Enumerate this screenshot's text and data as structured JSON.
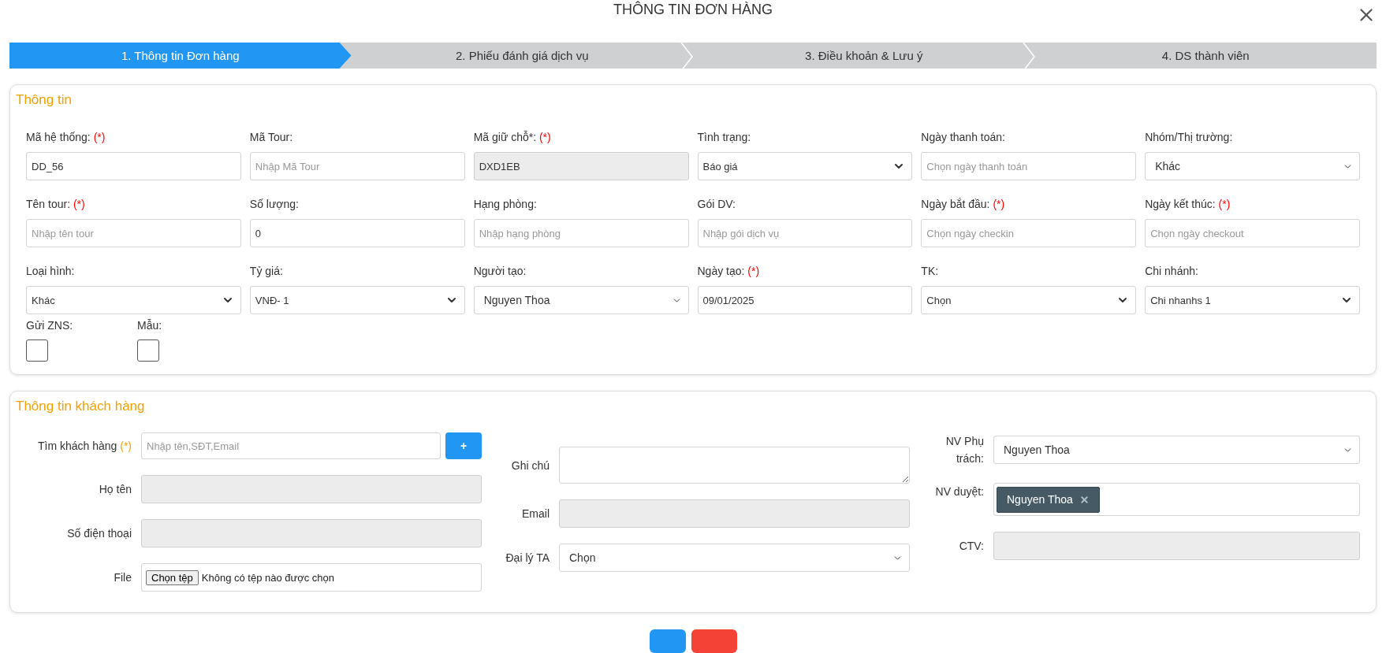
{
  "dialog": {
    "title": "THÔNG TIN ĐƠN HÀNG"
  },
  "steps": [
    {
      "label": "1. Thông tin Đơn hàng",
      "selected": true
    },
    {
      "label": "2. Phiếu đánh giá dịch vụ",
      "selected": false
    },
    {
      "label": "3. Điều khoản & Lưu ý",
      "selected": false
    },
    {
      "label": "4. DS thành viên",
      "selected": false
    }
  ],
  "order_info": {
    "heading": "Thông tin",
    "fields": [
      {
        "label": "Mã hệ thống:",
        "mark": "(*)",
        "kind": "text",
        "value": "DD_56",
        "disabled": false
      },
      {
        "label": "Mã Tour:",
        "kind": "text",
        "placeholder": "Nhập Mã Tour",
        "disabled": false
      },
      {
        "label": "Mã giữ chỗ*:",
        "mark": "(*)",
        "kind": "text",
        "value": "DXD1EB",
        "disabled": true
      },
      {
        "label": "Tình trạng:",
        "kind": "select",
        "value": "Báo giá",
        "disabled": false
      },
      {
        "label": "Ngày thanh toán:",
        "kind": "text",
        "placeholder": "Chọn ngày thanh toán",
        "disabled": false
      },
      {
        "label": "Nhóm/Thị trường:",
        "kind": "select2",
        "value": "Khác",
        "disabled": false
      },
      {
        "label": "Tên tour:",
        "mark": "(*)",
        "kind": "text",
        "placeholder": "Nhập tên tour",
        "disabled": false
      },
      {
        "label": "Số lượng:",
        "kind": "text",
        "value": "0",
        "disabled": false
      },
      {
        "label": "Hạng phòng:",
        "kind": "text",
        "placeholder": "Nhập hạng phòng",
        "disabled": false
      },
      {
        "label": "Gói DV:",
        "kind": "text",
        "placeholder": "Nhập gói dịch vụ",
        "disabled": false
      },
      {
        "label": "Ngày bắt đầu:",
        "mark": "(*)",
        "kind": "text",
        "placeholder": "Chọn ngày checkin",
        "disabled": false
      },
      {
        "label": "Ngày kết thúc:",
        "mark": "(*)",
        "kind": "text",
        "placeholder": "Chọn ngày checkout",
        "disabled": false
      },
      {
        "label": "Loại hình:",
        "kind": "select",
        "value": "Khác",
        "disabled": false
      },
      {
        "label": "Tỷ giá:",
        "kind": "select",
        "value": "VNĐ- 1",
        "disabled": false
      },
      {
        "label": "Người tạo:",
        "kind": "select2",
        "value": "Nguyen Thoa",
        "disabled": false
      },
      {
        "label": "Ngày tạo:",
        "mark": "(*)",
        "kind": "text",
        "value": "09/01/2025",
        "disabled": false
      },
      {
        "label": "TK:",
        "kind": "select",
        "value": "Chọn",
        "disabled": false
      },
      {
        "label": "Chi nhánh:",
        "kind": "select",
        "value": "Chi nhanhs 1",
        "disabled": false
      }
    ],
    "checkboxes": [
      {
        "label": "Gửi ZNS:",
        "checked": false
      },
      {
        "label": "Mẫu:",
        "checked": false
      }
    ]
  },
  "customer_info": {
    "heading": "Thông tin khách hàng",
    "columns": [
      [
        {
          "label": "Tìm khách hàng",
          "mark": "(*)",
          "kind": "search",
          "placeholder": "Nhập tên,SĐT,Email",
          "button": "+",
          "disabled": false
        },
        {
          "label": "Họ tên",
          "kind": "text",
          "disabled": true
        },
        {
          "label": "Số điện thoại",
          "kind": "text",
          "disabled": true
        },
        {
          "label": "File",
          "kind": "file",
          "button": "Chọn tệp",
          "value": "Không có tệp nào được chọn",
          "disabled": false
        }
      ],
      [
        {
          "label": "Ghi chú",
          "kind": "textarea",
          "disabled": false
        },
        {
          "label": "Email",
          "kind": "text",
          "disabled": true
        },
        {
          "label": "Đại lý TA",
          "kind": "select2",
          "value": "Chọn",
          "disabled": false
        }
      ],
      [
        {
          "label": "NV Phụ trách:",
          "kind": "select2",
          "value": "Nguyen Thoa",
          "disabled": false
        },
        {
          "label": "NV duyệt:",
          "kind": "tags",
          "tags": [
            "Nguyen Thoa"
          ],
          "disabled": false
        },
        {
          "label": "CTV:",
          "kind": "text",
          "disabled": true
        }
      ]
    ]
  },
  "footer_buttons": [
    {
      "kind": "primary"
    },
    {
      "kind": "danger"
    }
  ]
}
